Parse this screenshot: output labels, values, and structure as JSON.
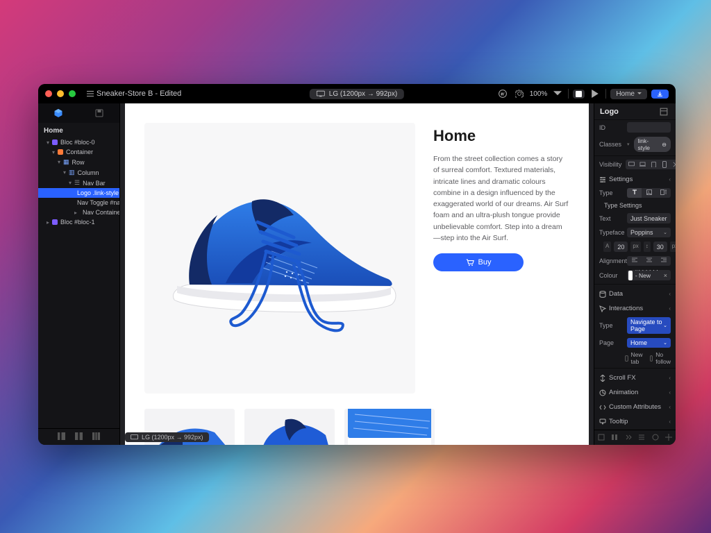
{
  "titlebar": {
    "project_title": "Sneaker-Store B - Edited",
    "breakpoint_label": "LG (1200px → 992px)",
    "zoom": "100%",
    "page_dropdown": "Home"
  },
  "sidebar": {
    "section_label": "Home",
    "tree": {
      "bloc0": "Bloc #bloc-0",
      "container": "Container",
      "row": "Row",
      "column": "Column",
      "navbar": "Nav Bar",
      "logo": "Logo .link-style",
      "navtoggle": "Nav Toggle #nav-toggle",
      "navcontainer": "Nav Container",
      "bloc1": "Bloc #bloc-1"
    }
  },
  "canvas": {
    "heading": "Home",
    "body_text": "From the street collection comes a story of surreal comfort. Textured materials, intricate lines and dramatic colours combine in a design influenced by the exaggerated world of our dreams. Air Surf foam and an ultra-plush tongue provide unbelievable comfort. Step into a dream—step into the Air Surf.",
    "buy_label": "Buy",
    "status": "LG (1200px → 992px)"
  },
  "inspector": {
    "title": "Logo",
    "id_label": "ID",
    "id_value": "",
    "classes_label": "Classes",
    "class_chip": "link-style",
    "visibility_label": "Visibility",
    "settings_label": "Settings",
    "type_label": "Type",
    "type_settings_label": "Type Settings",
    "text_label": "Text",
    "text_value": "Just Sneakers",
    "typeface_label": "Typeface",
    "typeface_value": "Poppins",
    "size_value": "20",
    "size_unit": "px",
    "lineheight_value": "30",
    "lineheight_unit": "px",
    "alignment_label": "Alignment",
    "colour_label": "Colour",
    "colour_value": "#FFFFFF - New Swatch",
    "data_label": "Data",
    "interactions_label": "Interactions",
    "int_type_label": "Type",
    "int_type_value": "Navigate to Page",
    "page_label": "Page",
    "page_value": "Home",
    "newtab_label": "New tab",
    "nofollow_label": "No follow",
    "scrollfx_label": "Scroll FX",
    "animation_label": "Animation",
    "custom_attr_label": "Custom Attributes",
    "tooltip_label": "Tooltip"
  }
}
